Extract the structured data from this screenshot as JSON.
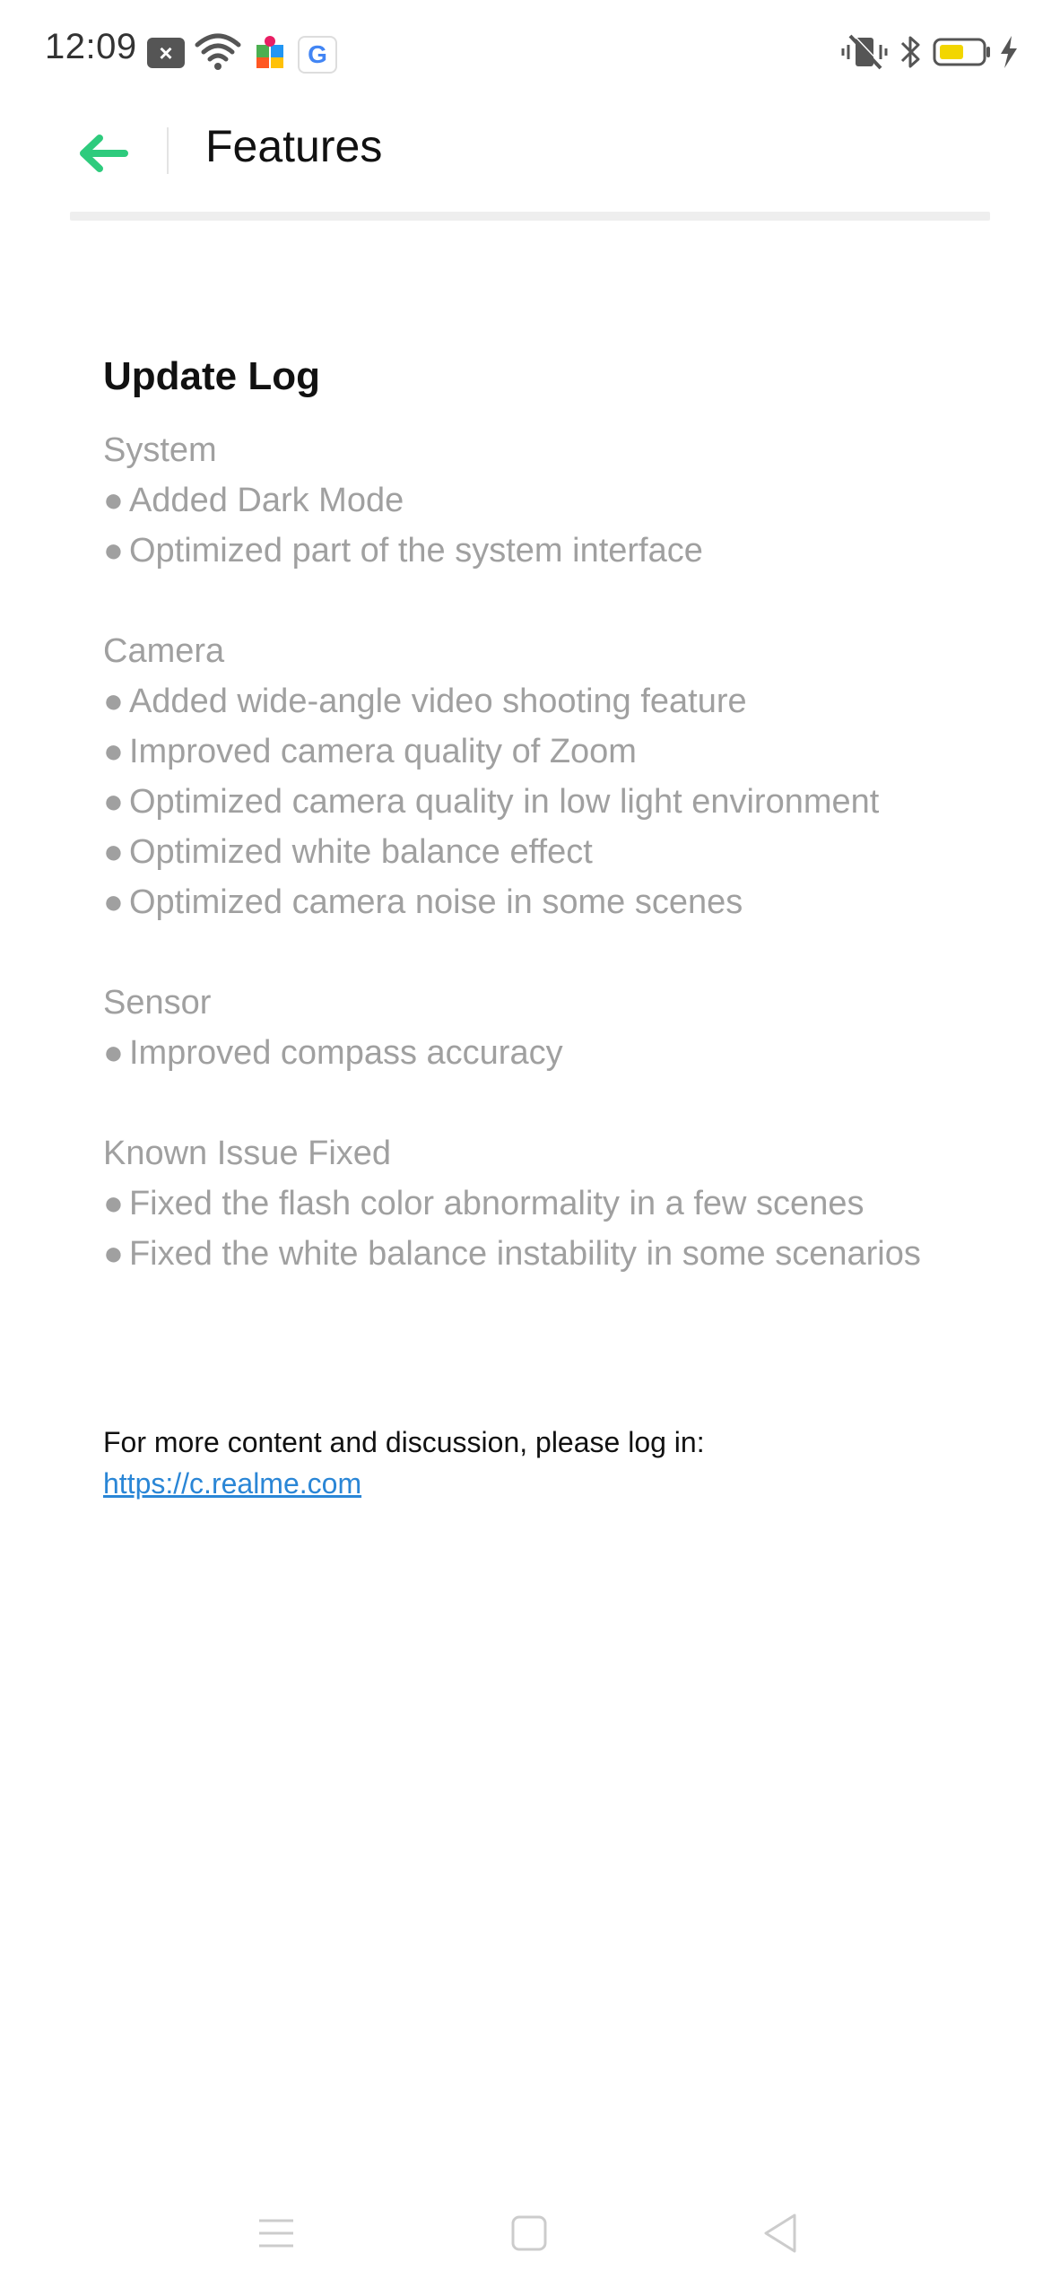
{
  "status_bar": {
    "time": "12:09",
    "icons": [
      "notification-x-icon",
      "wifi-icon",
      "puzzle-app-icon",
      "google-icon",
      "vibrate-off-icon",
      "bluetooth-icon",
      "battery-icon",
      "charging-icon"
    ],
    "google_letter": "G",
    "notif_letter": "×"
  },
  "header": {
    "title": "Features",
    "back_icon": "back-arrow-icon",
    "accent_color": "#2ecb7d"
  },
  "content": {
    "title": "Update Log",
    "sections": [
      {
        "name": "System",
        "items": [
          "Added Dark Mode",
          "Optimized part of the system interface"
        ]
      },
      {
        "name": "Camera",
        "items": [
          "Added wide-angle video shooting feature",
          "Improved camera quality of Zoom",
          "Optimized camera  quality in low light environment",
          "Optimized white balance effect",
          "Optimized camera noise in some scenes"
        ]
      },
      {
        "name": "Sensor",
        "items": [
          "Improved compass accuracy"
        ]
      },
      {
        "name": "Known Issue Fixed",
        "items": [
          "Fixed the flash color abnormality in a few scenes",
          "Fixed the white balance instability in some scenarios"
        ]
      }
    ],
    "bullet": "●"
  },
  "footer": {
    "more_text": "For more content and discussion, please log in:",
    "link": "https://c.realme.com",
    "link_color": "#2a86d6"
  },
  "nav_bar": {
    "buttons": [
      "menu-icon",
      "home-icon",
      "back-triangle-icon"
    ]
  }
}
